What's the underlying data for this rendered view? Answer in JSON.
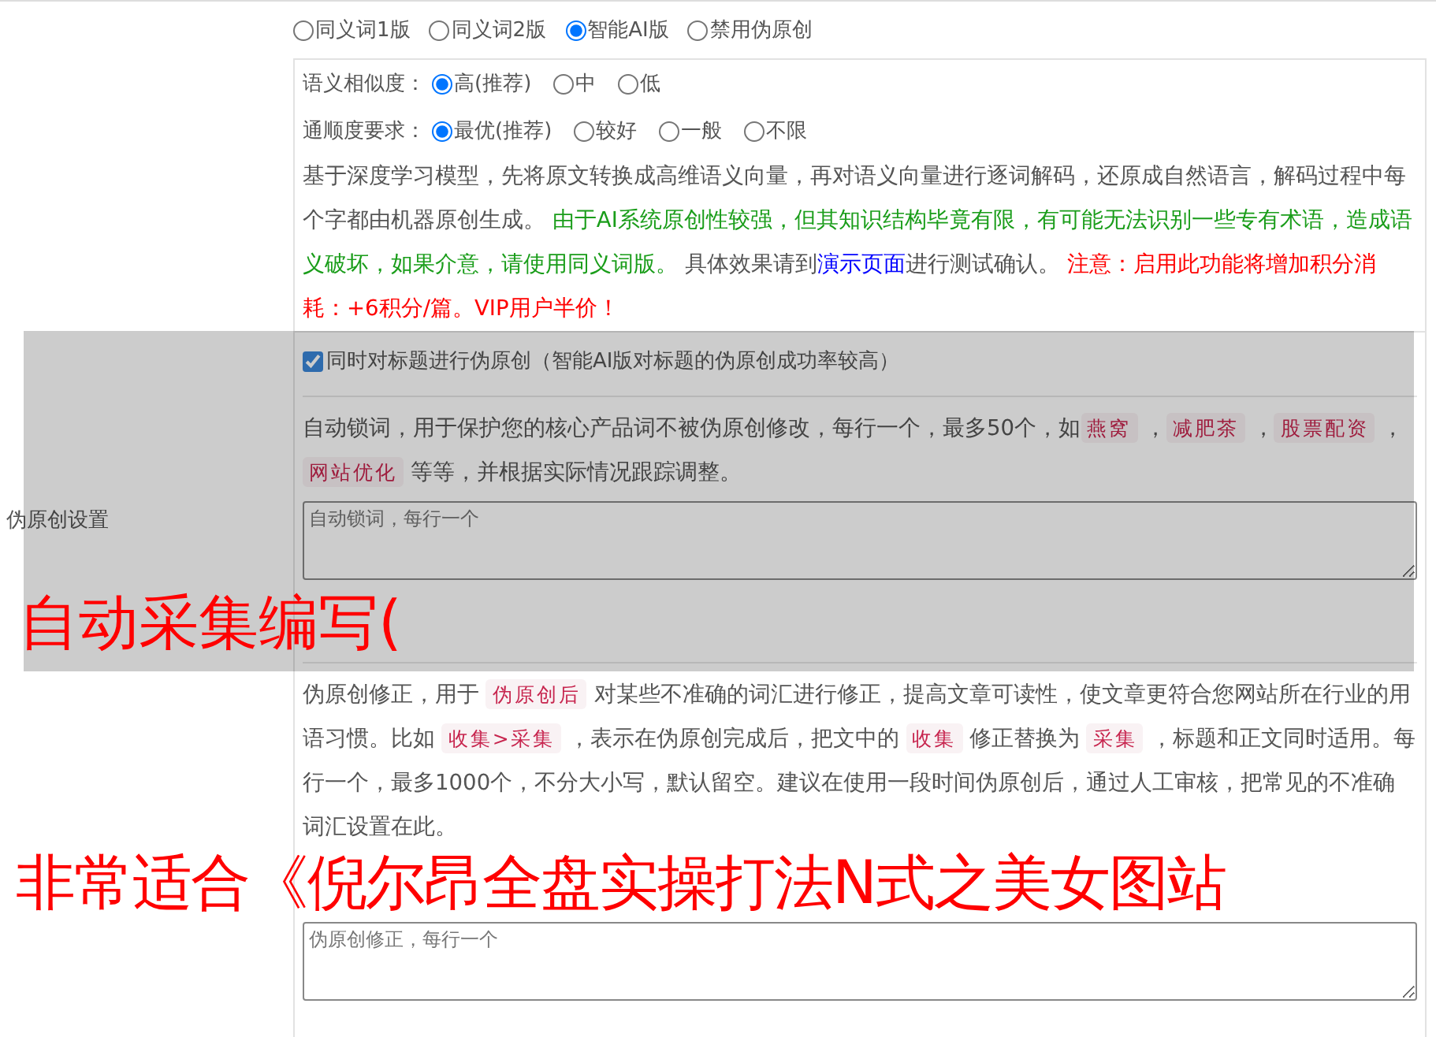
{
  "side_label": "伪原创设置",
  "versions": [
    {
      "label": "同义词1版",
      "selected": false
    },
    {
      "label": "同义词2版",
      "selected": false
    },
    {
      "label": "智能AI版",
      "selected": true
    },
    {
      "label": "禁用伪原创",
      "selected": false
    }
  ],
  "similarity": {
    "label": "语义相似度：",
    "options": [
      {
        "label": "高(推荐)",
        "selected": true
      },
      {
        "label": "中",
        "selected": false
      },
      {
        "label": "低",
        "selected": false
      }
    ]
  },
  "fluency": {
    "label": "通顺度要求：",
    "options": [
      {
        "label": "最优(推荐)",
        "selected": true
      },
      {
        "label": "较好",
        "selected": false
      },
      {
        "label": "一般",
        "selected": false
      },
      {
        "label": "不限",
        "selected": false
      }
    ]
  },
  "description": [
    {
      "kind": "text",
      "text": "基于深度学习模型，先将原文转换成高维语义向量，再对语义向量进行逐词解码，还原成自然语言，解码过程中每个字都由机器原创生成。 "
    },
    {
      "kind": "note",
      "text": "由于AI系统原创性较强，但其知识结构毕竟有限，有可能无法识别一些专有术语，造成语义破坏，如果介意，请使用同义词版。"
    },
    {
      "kind": "text",
      "text": " 具体效果请到"
    },
    {
      "kind": "link",
      "text": "演示页面"
    },
    {
      "kind": "text",
      "text": "进行测试确认。 "
    },
    {
      "kind": "warning",
      "text": "注意：启用此功能将增加积分消耗：+6积分/篇。VIP用户半价！"
    }
  ],
  "title_option": {
    "label": "同时对标题进行伪原创（智能AI版对标题的伪原创成功率较高）",
    "checked": true
  },
  "lock_words": {
    "description": [
      {
        "kind": "text",
        "text": "自动锁词，用于保护您的核心产品词不被伪原创修改，每行一个，最多50个，如"
      },
      {
        "kind": "tag",
        "text": "燕窝"
      },
      {
        "kind": "text",
        "text": " ，"
      },
      {
        "kind": "tag",
        "text": "减肥茶"
      },
      {
        "kind": "text",
        "text": " ，"
      },
      {
        "kind": "tag",
        "text": "股票配资"
      },
      {
        "kind": "text",
        "text": " ，"
      },
      {
        "kind": "tag",
        "text": "网站优化"
      },
      {
        "kind": "text",
        "text": " 等等，并根据实际情况跟踪调整。"
      }
    ],
    "placeholder": "自动锁词，每行一个"
  },
  "corrections": {
    "description": [
      {
        "kind": "text",
        "text": "伪原创修正，用于 "
      },
      {
        "kind": "tag",
        "text": "伪原创后"
      },
      {
        "kind": "text",
        "text": " 对某些不准确的词汇进行修正，提高文章可读性，使文章更符合您网站所在行业的用语习惯。比如 "
      },
      {
        "kind": "tag",
        "text": "收集>采集"
      },
      {
        "kind": "text",
        "text": " ，表示在伪原创完成后，把文中的 "
      },
      {
        "kind": "tag",
        "text": "收集"
      },
      {
        "kind": "text",
        "text": " 修正替换为 "
      },
      {
        "kind": "tag",
        "text": "采集"
      },
      {
        "kind": "text",
        "text": " ，标题和正文同时适用。每行一个，最多1000个，不分大小写，默认留空。建议在使用一段时间伪原创后，通过人工审核，把常见的不准确词汇设置在此。"
      }
    ],
    "placeholder": "伪原创修正，每行一个"
  },
  "overlay": {
    "lines": [
      "自动采集编写(",
      "非常适合《倪尔昂全盘实操打法N式之美女图站"
    ]
  }
}
